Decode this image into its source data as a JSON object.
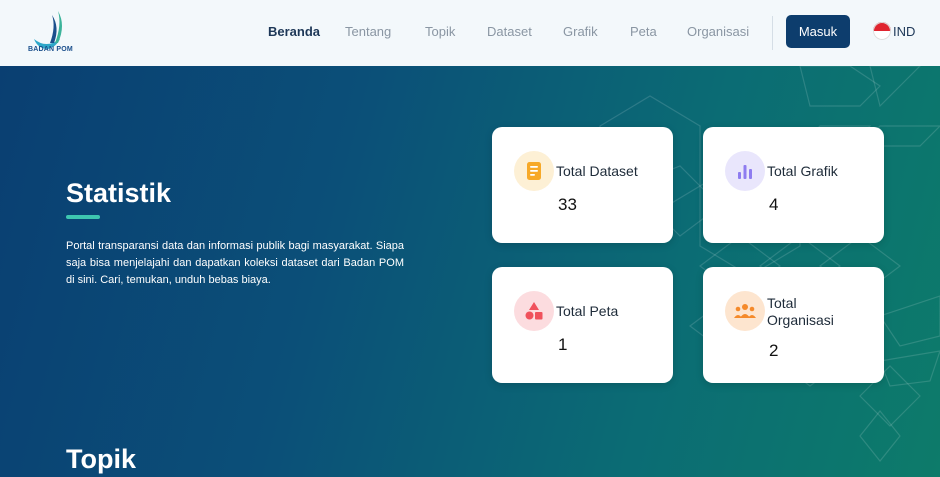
{
  "header": {
    "logo_text": "BADAN POM",
    "nav": [
      {
        "label": "Beranda",
        "active": true
      },
      {
        "label": "Tentang",
        "active": false
      },
      {
        "label": "Topik",
        "active": false
      },
      {
        "label": "Dataset",
        "active": false
      },
      {
        "label": "Grafik",
        "active": false
      },
      {
        "label": "Peta",
        "active": false
      },
      {
        "label": "Organisasi",
        "active": false
      }
    ],
    "login_label": "Masuk",
    "language": "IND",
    "language_icon": "indonesia-flag-icon"
  },
  "hero": {
    "title": "Statistik",
    "description": "Portal transparansi data dan informasi publik bagi masyarakat. Siapa saja bisa menjelajahi dan dapatkan koleksi dataset dari Badan POM di sini. Cari, temukan, unduh bebas biaya."
  },
  "stats": [
    {
      "label": "Total Dataset",
      "value": "33",
      "icon": "document-icon",
      "color": "#f7a928"
    },
    {
      "label": "Total Grafik",
      "value": "4",
      "icon": "bar-chart-icon",
      "color": "#8e7cf0"
    },
    {
      "label": "Total Peta",
      "value": "1",
      "icon": "shapes-icon",
      "color": "#f0515c"
    },
    {
      "label": "Total Organisasi",
      "value": "2",
      "icon": "people-group-icon",
      "color": "#f58a2a"
    }
  ],
  "next_section": {
    "title": "Topik"
  },
  "colors": {
    "brand_dark": "#0d3d6d",
    "accent": "#3ec6b0",
    "hero_start": "#0a3f72",
    "hero_end": "#0d7b6a"
  }
}
